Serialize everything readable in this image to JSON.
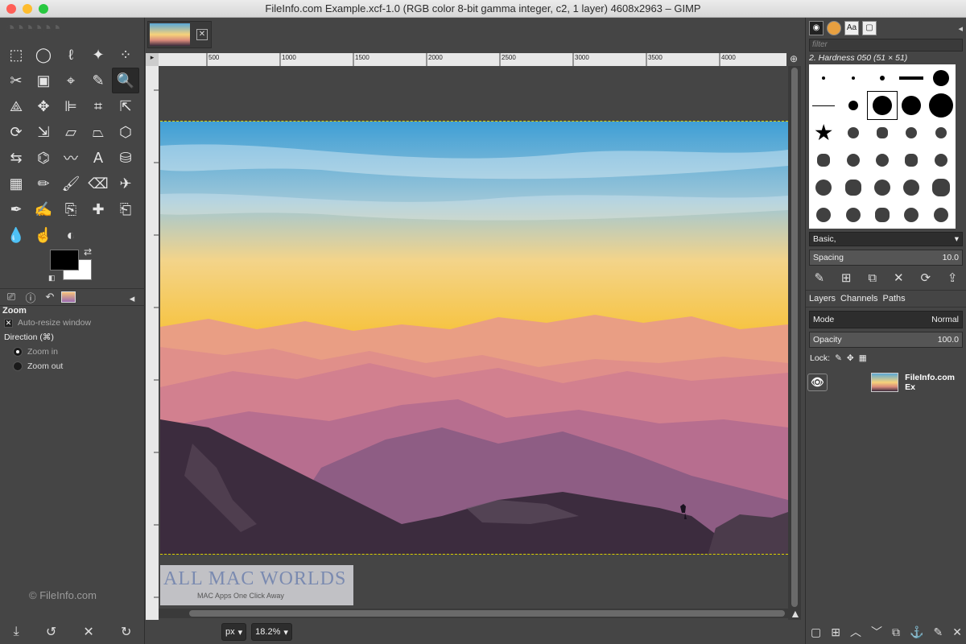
{
  "window": {
    "title": "FileInfo.com Example.xcf-1.0 (RGB color 8-bit gamma integer, c2, 1 layer) 4608x2963 – GIMP",
    "traffic_colors": [
      "#ff5f57",
      "#febc2e",
      "#28c840"
    ]
  },
  "toolbox": {
    "tools": [
      {
        "name": "rect-select-icon",
        "glyph": "⬚"
      },
      {
        "name": "ellipse-select-icon",
        "glyph": "◯"
      },
      {
        "name": "free-select-icon",
        "glyph": "ℓ"
      },
      {
        "name": "fuzzy-select-icon",
        "glyph": "✦"
      },
      {
        "name": "select-by-color-icon",
        "glyph": "⁘"
      },
      {
        "name": "scissors-icon",
        "glyph": "✂"
      },
      {
        "name": "foreground-select-icon",
        "glyph": "▣"
      },
      {
        "name": "paths-icon",
        "glyph": "⌖"
      },
      {
        "name": "color-picker-icon",
        "glyph": "✎"
      },
      {
        "name": "zoom-icon",
        "glyph": "🔍"
      },
      {
        "name": "measure-icon",
        "glyph": "⟁"
      },
      {
        "name": "move-icon",
        "glyph": "✥"
      },
      {
        "name": "align-icon",
        "glyph": "⊫"
      },
      {
        "name": "crop-icon",
        "glyph": "⌗"
      },
      {
        "name": "unified-transform-icon",
        "glyph": "⇱"
      },
      {
        "name": "rotate-icon",
        "glyph": "⟳"
      },
      {
        "name": "scale-icon",
        "glyph": "⇲"
      },
      {
        "name": "shear-icon",
        "glyph": "▱"
      },
      {
        "name": "perspective-icon",
        "glyph": "⏢"
      },
      {
        "name": "3d-transform-icon",
        "glyph": "⬡"
      },
      {
        "name": "flip-icon",
        "glyph": "⇆"
      },
      {
        "name": "cage-icon",
        "glyph": "⌬"
      },
      {
        "name": "warp-icon",
        "glyph": "〰"
      },
      {
        "name": "text-icon",
        "glyph": "A"
      },
      {
        "name": "bucket-fill-icon",
        "glyph": "⛁"
      },
      {
        "name": "gradient-icon",
        "glyph": "▦"
      },
      {
        "name": "pencil-icon",
        "glyph": "✏"
      },
      {
        "name": "paintbrush-icon",
        "glyph": "🖌"
      },
      {
        "name": "eraser-icon",
        "glyph": "⌫"
      },
      {
        "name": "airbrush-icon",
        "glyph": "✈"
      },
      {
        "name": "ink-icon",
        "glyph": "✒"
      },
      {
        "name": "mypaint-brush-icon",
        "glyph": "✍"
      },
      {
        "name": "clone-icon",
        "glyph": "⎘"
      },
      {
        "name": "heal-icon",
        "glyph": "✚"
      },
      {
        "name": "perspective-clone-icon",
        "glyph": "⎗"
      },
      {
        "name": "blur-icon",
        "glyph": "💧"
      },
      {
        "name": "smudge-icon",
        "glyph": "☝"
      },
      {
        "name": "dodge-burn-icon",
        "glyph": "◐"
      }
    ],
    "active_tool_index": 9,
    "swap_glyph": "⇄",
    "reset_glyph": "◧"
  },
  "tool_options": {
    "tab_glyphs": [
      "⎚",
      "ⓘ",
      "↶"
    ],
    "menu_glyph": "◂",
    "title": "Zoom",
    "auto_resize": {
      "label": "Auto-resize window",
      "mark": "✕"
    },
    "direction_label": "Direction  (⌘)",
    "zoom_in_label": "Zoom in",
    "zoom_out_label": "Zoom out",
    "copyright": "© FileInfo.com",
    "bottom_glyphs": [
      "⤓",
      "↺",
      "✕",
      "↻"
    ]
  },
  "canvas": {
    "tab_close": "✕",
    "ruler_corner": "▸",
    "ruler_labels": [
      "500",
      "1000",
      "1500",
      "2000",
      "2500",
      "3000",
      "3500",
      "4000"
    ],
    "unit": "px",
    "zoom": "18.2%",
    "chevron": "▾",
    "nav_glyph": "⊕",
    "corner_glyph": "▲"
  },
  "watermark": {
    "title": "ALL MAC WORLDS",
    "subtitle": "MAC Apps One Click Away"
  },
  "brushes": {
    "tabs": [
      "◉",
      "",
      "Aa",
      "▢"
    ],
    "menu_glyph": "◂",
    "filter_placeholder": "filter",
    "selected_name": "2. Hardness 050 (51 × 51)",
    "preset": "Basic,",
    "spacing_label": "Spacing",
    "spacing_value": "10.0",
    "action_glyphs": [
      "✎",
      "⊞",
      "⧉",
      "✕",
      "⟳",
      "⇪"
    ]
  },
  "layers": {
    "tab_layers": "Layers",
    "tab_channels": "Channels",
    "tab_paths": "Paths",
    "mode_label": "Mode",
    "mode_value": "Normal",
    "opacity_label": "Opacity",
    "opacity_value": "100.0",
    "lock_label": "Lock:",
    "lock_glyphs": [
      "✎",
      "✥",
      "▦"
    ],
    "layer_name": "FileInfo.com Ex",
    "eye_glyph": "👁",
    "bottom_glyphs": [
      "▢",
      "⊞",
      "︿",
      "﹀",
      "⧉",
      "⚓",
      "✎",
      "✕"
    ]
  }
}
